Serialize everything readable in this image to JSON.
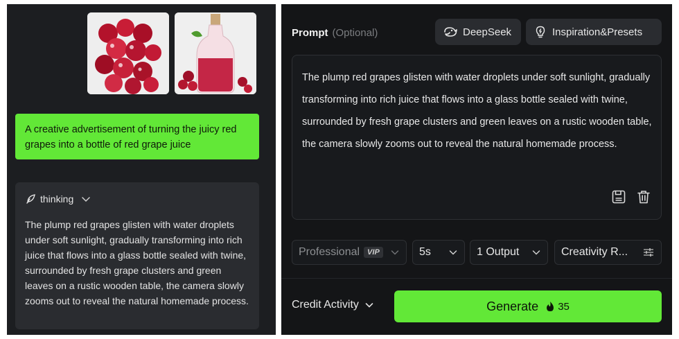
{
  "left": {
    "images": [
      {
        "alt_icon": "grapes-image"
      },
      {
        "alt_icon": "grape-juice-bottle-image"
      }
    ],
    "user_message": "A creative advertisement of turning the juicy red grapes into a bottle of red grape juice",
    "thinking": {
      "label": "thinking",
      "body": "The plump red grapes glisten with water droplets under soft sunlight, gradually transforming into rich juice that flows into a glass bottle sealed with twine, surrounded by fresh grape clusters and green leaves on a rustic wooden table, the camera slowly zooms out to reveal the natural homemade process."
    }
  },
  "right": {
    "prompt_label": "Prompt",
    "prompt_optional": "(Optional)",
    "deepseek_label": "DeepSeek",
    "inspiration_label": "Inspiration&Presets",
    "prompt_text": "The plump red grapes glisten with water droplets under soft sunlight, gradually transforming into rich juice that flows into a glass bottle sealed with twine, surrounded by fresh grape clusters and green leaves on a rustic wooden table, the camera slowly zooms out to reveal the natural homemade process.",
    "options": {
      "quality": "Professional",
      "quality_badge": "VIP",
      "duration": "5s",
      "outputs": "1 Output",
      "creativity": "Creativity R..."
    },
    "credit_activity": "Credit Activity",
    "generate_label": "Generate",
    "generate_cost": "35"
  },
  "colors": {
    "accent_green": "#62e837",
    "panel_dark": "#141517",
    "card_dark": "#2a2c30"
  }
}
